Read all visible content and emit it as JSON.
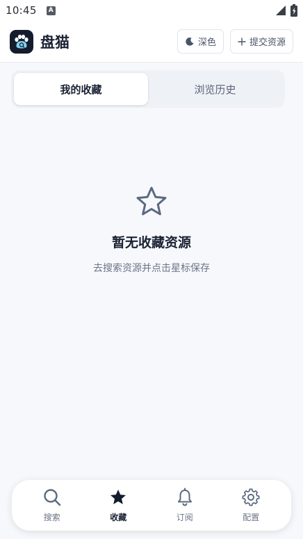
{
  "status_bar": {
    "time": "10:45",
    "indicator_letter": "A"
  },
  "header": {
    "app_title": "盘猫",
    "dark_mode_label": "深色",
    "submit_label": "提交资源"
  },
  "tabs": [
    {
      "label": "我的收藏",
      "active": true
    },
    {
      "label": "浏览历史",
      "active": false
    }
  ],
  "empty_state": {
    "icon": "star-outline-icon",
    "title": "暂无收藏资源",
    "subtitle": "去搜索资源并点击星标保存"
  },
  "bottom_nav": [
    {
      "label": "搜索",
      "icon": "search-icon",
      "active": false
    },
    {
      "label": "收藏",
      "icon": "star-icon",
      "active": true
    },
    {
      "label": "订阅",
      "icon": "bell-icon",
      "active": false
    },
    {
      "label": "配置",
      "icon": "gear-icon",
      "active": false
    }
  ],
  "colors": {
    "primary_text": "#1a2233",
    "secondary_text": "#6b7487",
    "logo_bg": "#141c2e",
    "page_bg": "#f7f8fb"
  }
}
